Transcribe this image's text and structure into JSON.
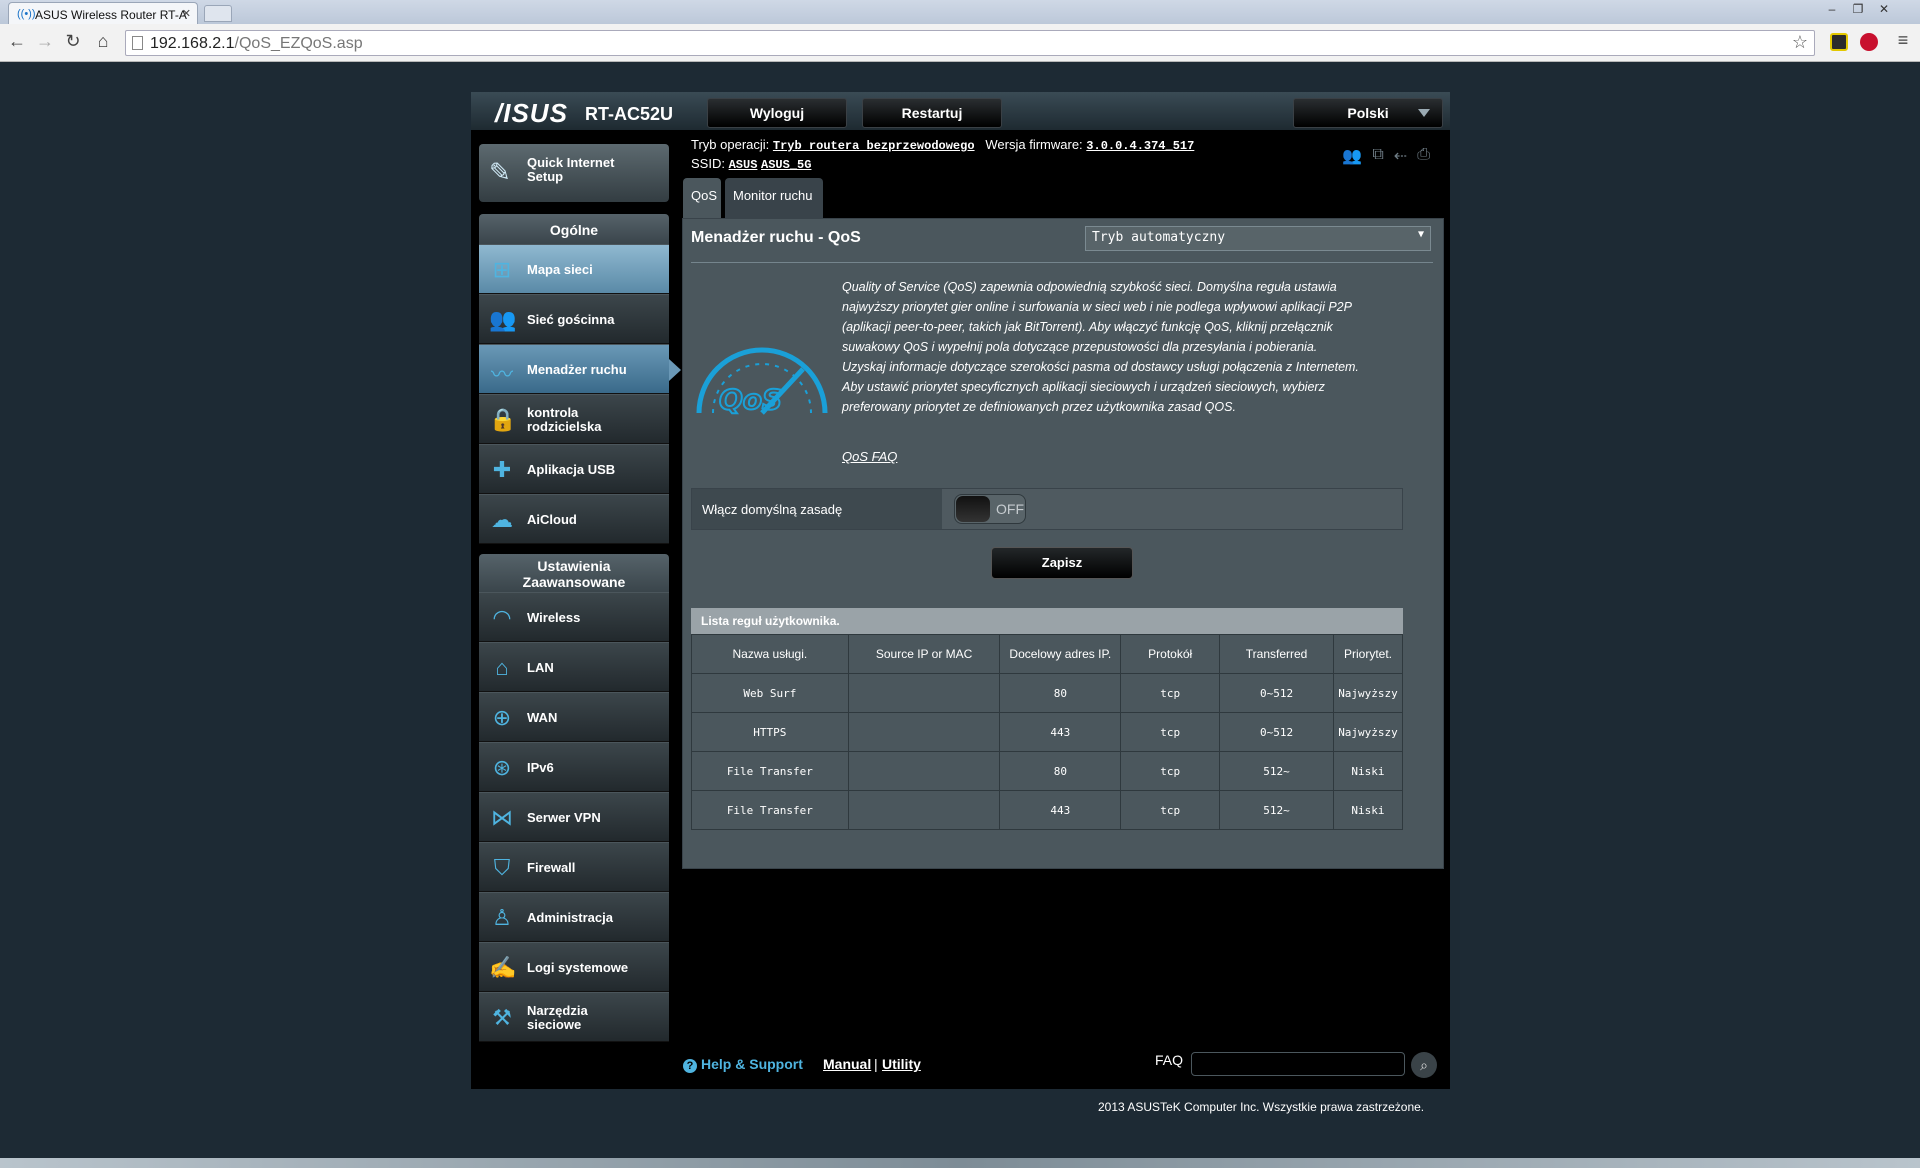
{
  "browser": {
    "tab_title": "ASUS Wireless Router RT-A",
    "url_host": "192.168.2.1",
    "url_path": "/QoS_EZQoS.asp"
  },
  "header": {
    "logo": "/ISUS",
    "model": "RT-AC52U",
    "logout": "Wyloguj",
    "restart": "Restartuj",
    "language": "Polski"
  },
  "info": {
    "mode_label": "Tryb operacji:",
    "mode_value": "Tryb routera bezprzewodowego",
    "fw_label": "Wersja firmware:",
    "fw_value": "3.0.0.4.374_517",
    "ssid_label": "SSID:",
    "ssid_1": "ASUS",
    "ssid_2": "ASUS_5G"
  },
  "sidebar": {
    "quick_setup": "Quick Internet Setup",
    "general_title": "Ogólne",
    "general": [
      {
        "label": "Mapa sieci",
        "icon": "network-map-icon"
      },
      {
        "label": "Sieć gościnna",
        "icon": "guest-network-icon"
      },
      {
        "label": "Menadżer ruchu",
        "icon": "traffic-manager-icon"
      },
      {
        "label": "kontrola rodzicielska",
        "icon": "lock-icon"
      },
      {
        "label": "Aplikacja USB",
        "icon": "puzzle-icon"
      },
      {
        "label": "AiCloud",
        "icon": "cloud-icon"
      }
    ],
    "advanced_title": "Ustawienia Zaawansowane",
    "advanced": [
      {
        "label": "Wireless",
        "icon": "wifi-icon"
      },
      {
        "label": "LAN",
        "icon": "home-icon"
      },
      {
        "label": "WAN",
        "icon": "globe-icon"
      },
      {
        "label": "IPv6",
        "icon": "ipv6-icon"
      },
      {
        "label": "Serwer VPN",
        "icon": "vpn-icon"
      },
      {
        "label": "Firewall",
        "icon": "shield-icon"
      },
      {
        "label": "Administracja",
        "icon": "admin-icon"
      },
      {
        "label": "Logi systemowe",
        "icon": "log-icon"
      },
      {
        "label": "Narzędzia sieciowe",
        "icon": "tools-icon"
      }
    ]
  },
  "tabs": {
    "qos": "QoS",
    "monitor": "Monitor ruchu"
  },
  "main": {
    "title": "Menadżer ruchu - QoS",
    "mode_selected": "Tryb automatyczny",
    "qos_logo_text": "QoS",
    "description_1": "Quality of Service (QoS) zapewnia odpowiednią szybkość sieci. Domyślna reguła ustawia najwyższy priorytet gier online i surfowania w sieci web i nie podlega wpływowi aplikacji P2P (aplikacji peer-to-peer, takich jak BitTorrent). Aby włączyć funkcję QoS, kliknij przełącznik suwakowy QoS i wypełnij pola dotyczące przepustowości dla przesyłania i pobierania. Uzyskaj informacje dotyczące szerokości pasma od dostawcy usługi połączenia z Internetem.",
    "description_2": "Aby ustawić priorytet specyficznych aplikacji sieciowych i urządzeń sieciowych, wybierz preferowany priorytet ze definiowanych przez użytkownika zasad QOS.",
    "faq_link": "QoS FAQ",
    "enable_label": "Włącz domyślną zasadę",
    "toggle_state": "OFF",
    "save": "Zapisz",
    "rules_title": "Lista reguł użytkownika.",
    "columns": [
      "Nazwa usługi.",
      "Source IP or MAC",
      "Docelowy adres IP.",
      "Protokół",
      "Transferred",
      "Priorytet."
    ],
    "rows": [
      [
        "Web Surf",
        "",
        "80",
        "tcp",
        "0~512",
        "Najwyższy"
      ],
      [
        "HTTPS",
        "",
        "443",
        "tcp",
        "0~512",
        "Najwyższy"
      ],
      [
        "File Transfer",
        "",
        "80",
        "tcp",
        "512~",
        "Niski"
      ],
      [
        "File Transfer",
        "",
        "443",
        "tcp",
        "512~",
        "Niski"
      ]
    ]
  },
  "footer": {
    "help": "Help & Support",
    "manual": "Manual",
    "separator": "|",
    "utility": "Utility",
    "faq": "FAQ",
    "copyright": "2013 ASUSTeK Computer Inc. Wszystkie prawa zastrzeżone."
  }
}
